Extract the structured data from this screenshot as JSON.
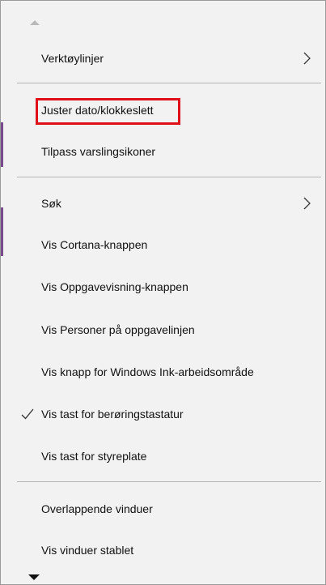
{
  "menu": {
    "items": [
      {
        "label": "Verktøylinjer",
        "submenu": true
      },
      {
        "label": "Juster dato/klokkeslett",
        "highlighted": true
      },
      {
        "label": "Tilpass varslingsikoner"
      },
      {
        "label": "Søk",
        "submenu": true
      },
      {
        "label": "Vis Cortana-knappen"
      },
      {
        "label": "Vis Oppgavevisning-knappen"
      },
      {
        "label": "Vis Personer på oppgavelinjen"
      },
      {
        "label": "Vis knapp for Windows Ink-arbeidsområde"
      },
      {
        "label": "Vis tast for berøringstastatur",
        "checked": true
      },
      {
        "label": "Vis tast for styreplate"
      },
      {
        "label": "Overlappende vinduer"
      },
      {
        "label": "Vis vinduer stablet"
      }
    ]
  },
  "colors": {
    "menu_background": "#f2f2f2",
    "highlight_border": "#e0101a",
    "separator": "#b5b5b5",
    "text": "#111111"
  },
  "icons": {
    "scroll_up": "scroll-up-arrow-icon",
    "scroll_down": "scroll-down-arrow-icon",
    "submenu": "chevron-right-icon",
    "check": "checkmark-icon"
  }
}
